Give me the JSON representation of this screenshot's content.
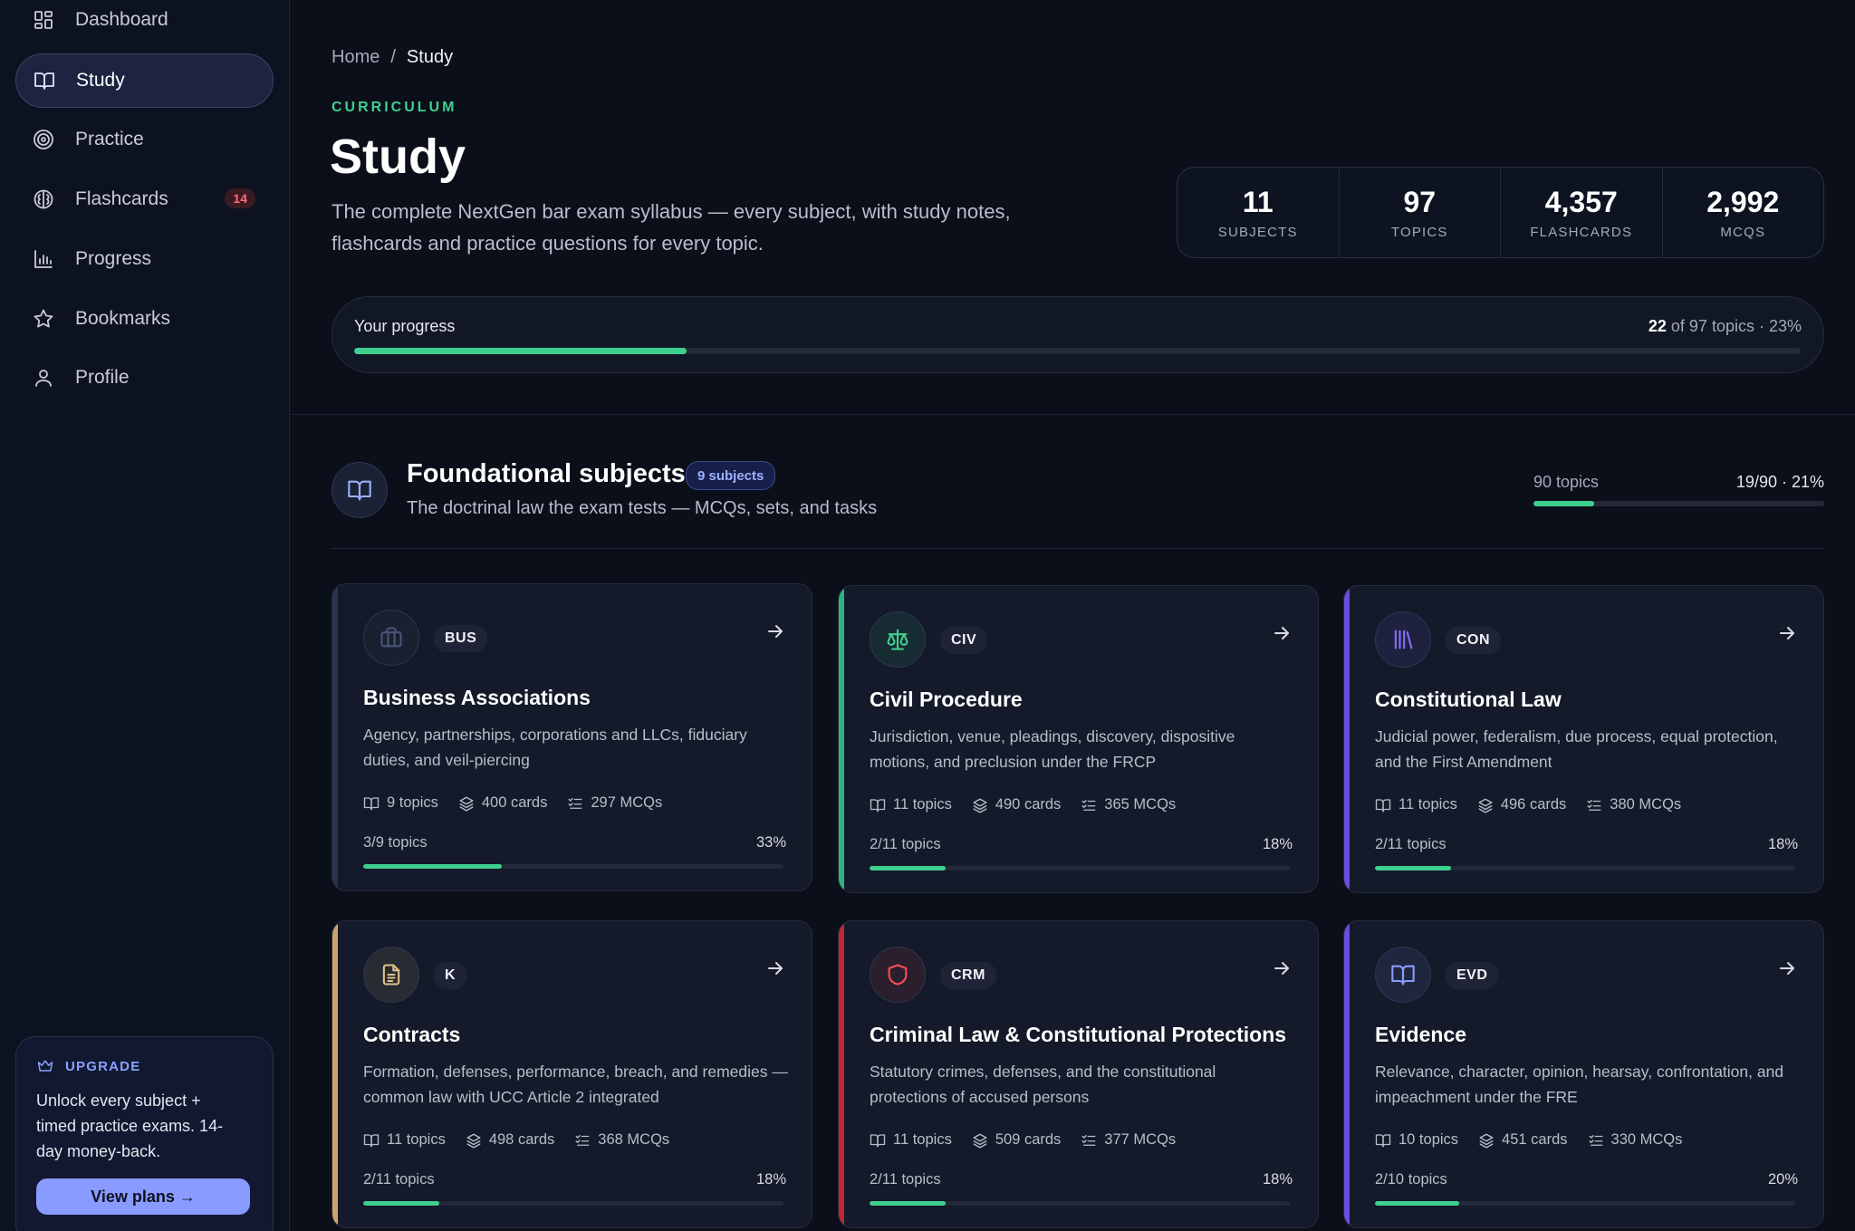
{
  "sidebar": {
    "items": [
      {
        "label": "Dashboard",
        "icon": "dashboard-icon"
      },
      {
        "label": "Study",
        "icon": "book-icon",
        "active": true
      },
      {
        "label": "Practice",
        "icon": "target-icon"
      },
      {
        "label": "Flashcards",
        "icon": "brain-icon",
        "badge": "14"
      },
      {
        "label": "Progress",
        "icon": "bar-chart-icon"
      },
      {
        "label": "Bookmarks",
        "icon": "star-icon"
      },
      {
        "label": "Profile",
        "icon": "user-icon"
      }
    ],
    "upgrade": {
      "heading": "UPGRADE",
      "text": "Unlock every subject + timed practice exams. 14-day money-back.",
      "button": "View plans →"
    }
  },
  "breadcrumb": {
    "home": "Home",
    "separator": "/",
    "current": "Study"
  },
  "header": {
    "eyebrow": "CURRICULUM",
    "title": "Study",
    "description": "The complete NextGen bar exam syllabus — every subject, with study notes, flashcards and practice questions for every topic."
  },
  "stats": [
    {
      "value": "11",
      "label": "SUBJECTS"
    },
    {
      "value": "97",
      "label": "TOPICS"
    },
    {
      "value": "4,357",
      "label": "FLASHCARDS"
    },
    {
      "value": "2,992",
      "label": "MCQS"
    }
  ],
  "progress": {
    "label": "Your progress",
    "done": "22",
    "rest": " of 97 topics · 23%",
    "fraction": 0.23
  },
  "section": {
    "title": "Foundational subjects",
    "pill": "9 subjects",
    "description": "The doctrinal law the exam tests — MCQs, sets, and tasks",
    "topics": "90 topics",
    "ratio": "19/90 · 21%",
    "fraction": 0.21
  },
  "colors": {
    "accent_green": "#3ecf8e",
    "accent_blue": "#8a9bff",
    "background": "#0b0f19"
  },
  "cards": [
    {
      "code": "BUS",
      "title": "Business Associations",
      "description": "Agency, partnerships, corporations and LLCs, fiduciary duties, and veil-piercing",
      "topics": "9 topics",
      "cards": "400 cards",
      "mcqs": "297 MCQs",
      "progress_label": "3/9 topics",
      "percent": "33%",
      "fraction": 0.33,
      "accent": "#2a3350",
      "icon": "briefcase-icon",
      "icon_color": "#4a5578"
    },
    {
      "code": "CIV",
      "title": "Civil Procedure",
      "description": "Jurisdiction, venue, pleadings, discovery, dispositive motions, and preclusion under the FRCP",
      "topics": "11 topics",
      "cards": "490 cards",
      "mcqs": "365 MCQs",
      "progress_label": "2/11 topics",
      "percent": "18%",
      "fraction": 0.18,
      "accent": "#2bb37f",
      "icon": "scale-icon",
      "icon_color": "#3ecf8e"
    },
    {
      "code": "CON",
      "title": "Constitutional Law",
      "description": "Judicial power, federalism, due process, equal protection, and the First Amendment",
      "topics": "11 topics",
      "cards": "496 cards",
      "mcqs": "380 MCQs",
      "progress_label": "2/11 topics",
      "percent": "18%",
      "fraction": 0.18,
      "accent": "#6a4ee0",
      "icon": "library-icon",
      "icon_color": "#8a6dff"
    },
    {
      "code": "K",
      "title": "Contracts",
      "description": "Formation, defenses, performance, breach, and remedies — common law with UCC Article 2 integrated",
      "topics": "11 topics",
      "cards": "498 cards",
      "mcqs": "368 MCQs",
      "progress_label": "2/11 topics",
      "percent": "18%",
      "fraction": 0.18,
      "accent": "#c9a56a",
      "icon": "document-icon",
      "icon_color": "#e0c08a"
    },
    {
      "code": "CRM",
      "title": "Criminal Law & Constitutional Protections",
      "description": "Statutory crimes, defenses, and the constitutional protections of accused persons",
      "topics": "11 topics",
      "cards": "509 cards",
      "mcqs": "377 MCQs",
      "progress_label": "2/11 topics",
      "percent": "18%",
      "fraction": 0.18,
      "accent": "#c0282f",
      "icon": "shield-icon",
      "icon_color": "#ff4a55"
    },
    {
      "code": "EVD",
      "title": "Evidence",
      "description": "Relevance, character, opinion, hearsay, confrontation, and impeachment under the FRE",
      "topics": "10 topics",
      "cards": "451 cards",
      "mcqs": "330 MCQs",
      "progress_label": "2/10 topics",
      "percent": "20%",
      "fraction": 0.2,
      "accent": "#6a4ee0",
      "icon": "book-icon",
      "icon_color": "#8a9bff"
    }
  ]
}
